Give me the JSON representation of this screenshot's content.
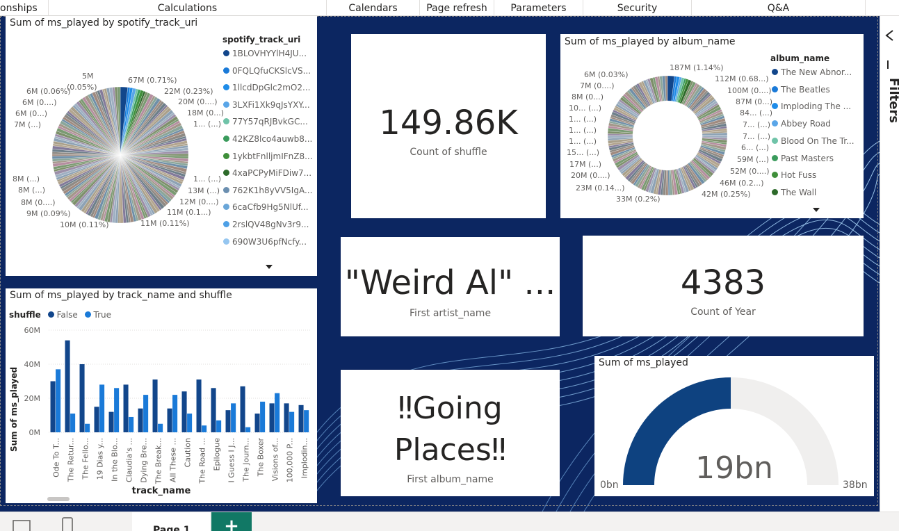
{
  "ribbon": {
    "groups": [
      "onships",
      "Calculations",
      "Calendars",
      "Page refresh",
      "Parameters",
      "Security",
      "Q&A"
    ]
  },
  "filters_pane": {
    "label": "Filters"
  },
  "footer": {
    "page_tab": "Page 1",
    "add_page": "+"
  },
  "visuals": {
    "pie_uri": {
      "title": "Sum of ms_played by spotify_track_uri",
      "legend_title": "spotify_track_uri",
      "legend_items": [
        "1BLOVHYYlH4JU...",
        "0FQLQfuCKSlcVS...",
        "1llcdDpGlc2mO2...",
        "3LXFi1Xk9qJsYXY...",
        "77Y57qRJBvkGC...",
        "42KZ8lco4auwb8...",
        "1ykbtFnlljmIFnZ8...",
        "4xaPCPyMiFDiw7...",
        "762K1h8yVV5IgA...",
        "6caCfb9Hg5NlUf...",
        "2rslQV48gNv3r9...",
        "690W3U6pfNcfy..."
      ],
      "labels": [
        "67M (0.71%)",
        "22M (0.23%)",
        "20M (0....)",
        "18M (0...)",
        "1... (...)",
        "1... (...)",
        "13M (...)",
        "12M (0....)",
        "11M (0.1...)",
        "11M (0.11%)",
        "10M (0.11%)",
        "9M (0.09%)",
        "8M (0....)",
        "8M (...)",
        "8M (...)",
        "5M",
        "(0.05%)",
        "6M (0.06%)",
        "6M (0....)",
        "6M (0...)",
        "7M (...)"
      ]
    },
    "card_shuffle": {
      "value": "149.86K",
      "label": "Count of shuffle"
    },
    "donut_album": {
      "title": "Sum of ms_played by album_name",
      "legend_title": "album_name",
      "legend_items": [
        "The New Abnor...",
        "The Beatles",
        "Imploding The ...",
        "Abbey Road",
        "Blood On The Tr...",
        "Past Masters",
        "Hot Fuss",
        "The Wall"
      ],
      "labels": [
        "187M (1.14%)",
        "112M (0.68...)",
        "100M (0....)",
        "87M (0...)",
        "84... (...)",
        "7... (...)",
        "7... (...)",
        "6... (...)",
        "59M (...)",
        "52M (0....)",
        "46M (0.2...)",
        "42M (0.25%)",
        "33M (0.2%)",
        "23M (0.14...)",
        "20M (0....)",
        "17M (...)",
        "15... (...)",
        "1... (...)",
        "1... (...)",
        "1... (...)",
        "10... (...)",
        "8M (0...)",
        "7M (0....)",
        "6M (0.03%)"
      ]
    },
    "card_artist": {
      "value": "\"Weird Al\" ...",
      "label": "First artist_name"
    },
    "card_year": {
      "value": "4383",
      "label": "Count of Year"
    },
    "card_album": {
      "value_line1": "‼Going",
      "value_line2": "Places‼",
      "label": "First album_name"
    },
    "gauge": {
      "title": "Sum of ms_played",
      "value_label": "19bn",
      "min_label": "0bn",
      "max_label": "38bn"
    },
    "bar_chart": {
      "title": "Sum of ms_played by track_name and shuffle",
      "legend_title": "shuffle",
      "legend_false": "False",
      "legend_true": "True",
      "ylabel": "Sum of ms_played",
      "xlabel": "track_name",
      "yticks": [
        "60M",
        "40M",
        "20M",
        "0M"
      ]
    }
  },
  "chart_data": [
    {
      "type": "bar",
      "title": "Sum of ms_played by track_name and shuffle",
      "xlabel": "track_name",
      "ylabel": "Sum of ms_played",
      "ylim": [
        0,
        60
      ],
      "categories": [
        "Ode To T...",
        "The Retur...",
        "The Fello...",
        "19 Dias y...",
        "In the Blo...",
        "Claudia's ...",
        "Dying Bre...",
        "The Break...",
        "All These ...",
        "Caution",
        "The Road ...",
        "Epilogue",
        "I Guess I J...",
        "The Journ...",
        "The Boxer",
        "Visions of...",
        "100,000 P...",
        "Implodin..."
      ],
      "series": [
        {
          "name": "False",
          "color": "#12468b",
          "values": [
            30,
            54,
            40,
            15,
            12,
            28,
            14,
            31,
            14,
            24,
            31,
            26,
            13,
            27,
            11,
            17,
            17,
            16
          ]
        },
        {
          "name": "True",
          "color": "#1a7ad8",
          "values": [
            37,
            11,
            5,
            28,
            26,
            9,
            22,
            5,
            22,
            11,
            4,
            7,
            17,
            3,
            18,
            23,
            12,
            13
          ]
        }
      ],
      "grid": true,
      "legend": "top-left"
    },
    {
      "type": "pie",
      "title": "Sum of ms_played by spotify_track_uri",
      "labels": [
        "67M (0.71%)",
        "22M (0.23%)",
        "11M (0.11%)",
        "10M (0.11%)",
        "9M (0.09%)",
        "6M (0.06%)",
        "5M (0.05%)"
      ]
    },
    {
      "type": "pie",
      "title": "Sum of ms_played by album_name",
      "labels": [
        "187M (1.14%)",
        "112M (0.68...)",
        "42M (0.25%)",
        "33M (0.2%)",
        "6M (0.03%)"
      ]
    },
    {
      "type": "gauge",
      "title": "Sum of ms_played",
      "value": 19,
      "min": 0,
      "max": 38,
      "unit": "bn"
    }
  ],
  "colors": {
    "canvas_bg": "#0c2661",
    "series_false": "#12468b",
    "series_true": "#1a7ad8",
    "gauge_fill": "#0e4280",
    "gauge_track": "#f0efee",
    "add_page": "#117865"
  },
  "icons": [
    "filter-pane-chevron-icon",
    "mobile-layout-icon",
    "desktop-layout-icon",
    "more-options-icon"
  ]
}
